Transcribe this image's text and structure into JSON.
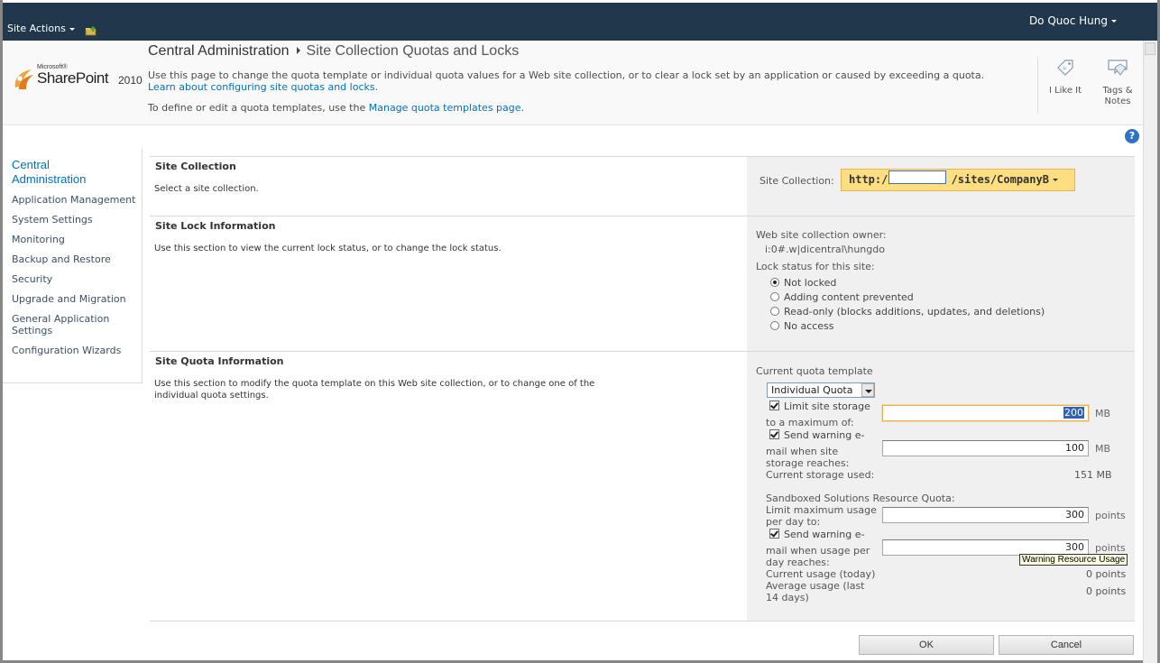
{
  "topbar": {
    "site_actions": "Site Actions",
    "user": "Do Quoc Hung"
  },
  "logo": {
    "microsoft": "Microsoft®",
    "product": "SharePoint",
    "year": "2010"
  },
  "breadcrumb": {
    "home": "Central Administration",
    "current": "Site Collection Quotas and Locks"
  },
  "description": {
    "line1": "Use this page to change the quota template or individual quota values for a Web site collection, or to clear a lock set by an application or caused by exceeding a quota.",
    "learn_link": "Learn about configuring site quotas and locks.",
    "line2_prefix": "To define or edit a quota templates, use the ",
    "manage_link": "Manage quota templates page",
    "line2_suffix": "."
  },
  "social": {
    "like": "I Like It",
    "tags_line1": "Tags &",
    "tags_line2": "Notes"
  },
  "leftnav": {
    "heading": "Central Administration",
    "items": [
      "Application Management",
      "System Settings",
      "Monitoring",
      "Backup and Restore",
      "Security",
      "Upgrade and Migration",
      "General Application Settings",
      "Configuration Wizards"
    ]
  },
  "site_collection": {
    "title": "Site Collection",
    "desc": "Select a site collection.",
    "label": "Site Collection:",
    "url_prefix": "http://",
    "url_suffix": "/sites/CompanyB"
  },
  "lock": {
    "title": "Site Lock Information",
    "desc": "Use this section to view the current lock status, or to change the lock status.",
    "owner_label": "Web site collection owner:",
    "owner_value": "i:0#.w|dicentral\\hungdo",
    "status_label": "Lock status for this site:",
    "options": [
      "Not locked",
      "Adding content prevented",
      "Read-only (blocks additions, updates, and deletions)",
      "No access"
    ],
    "selected": 0
  },
  "quota": {
    "title": "Site Quota Information",
    "desc_line1": "Use this section to modify the quota template on this Web site collection, or to change one of the",
    "desc_line2": "individual quota settings.",
    "template_label": "Current quota template",
    "template_value": "Individual Quota",
    "limit_label_a": "Limit site storage",
    "limit_label_b": "to a maximum of:",
    "limit_value": "200",
    "limit_checked": true,
    "warn_label_a": "Send warning e-",
    "warn_label_b": "mail when site",
    "warn_label_c": "storage reaches:",
    "warn_value": "100",
    "warn_checked": true,
    "mb": "MB",
    "used_label": "Current storage used:",
    "used_value": "151 MB",
    "sandbox_label": "Sandboxed Solutions Resource Quota:",
    "max_label_a": "Limit maximum usage",
    "max_label_b": "per day to:",
    "max_value": "300",
    "points": "points",
    "swarn_label_a": "Send warning e-",
    "swarn_label_b": "mail when usage per",
    "swarn_label_c": "day reaches:",
    "swarn_value": "300",
    "swarn_checked": true,
    "today_label": "Current usage (today)",
    "today_value": "0 points",
    "avg_label_a": "Average usage (last",
    "avg_label_b": "14 days)",
    "avg_value": "0 points",
    "tooltip": "Warning Resource Usage"
  },
  "buttons": {
    "ok": "OK",
    "cancel": "Cancel"
  },
  "colors": {
    "topbar": "#21374c",
    "link": "#0072bc",
    "picker": "#fddf81"
  }
}
